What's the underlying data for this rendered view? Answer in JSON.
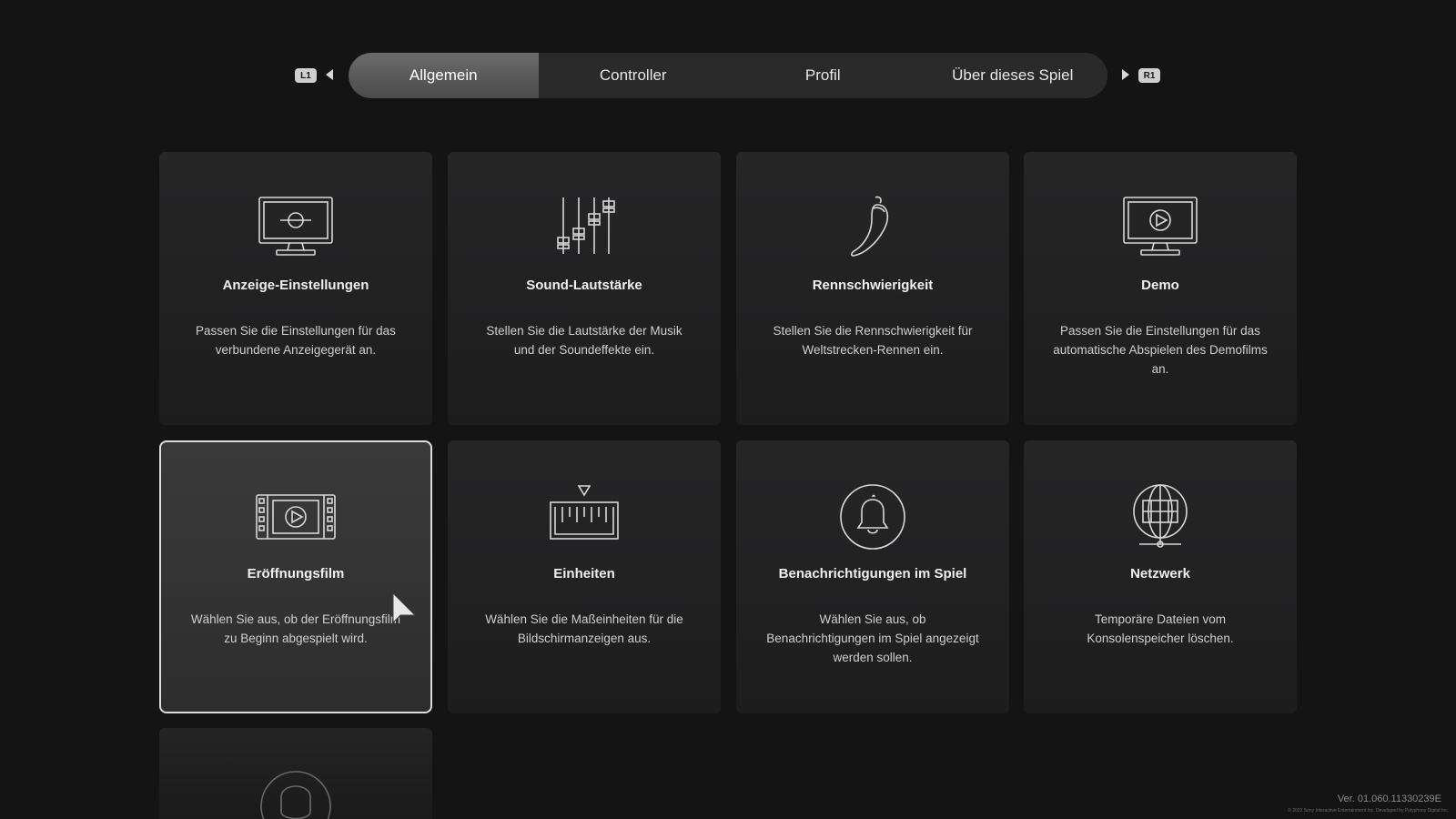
{
  "nav": {
    "left_hint": "L1",
    "right_hint": "R1",
    "tabs": [
      {
        "label": "Allgemein",
        "active": true
      },
      {
        "label": "Controller",
        "active": false
      },
      {
        "label": "Profil",
        "active": false
      },
      {
        "label": "Über dieses Spiel",
        "active": false
      }
    ]
  },
  "cards": [
    {
      "title": "Anzeige-Einstellungen",
      "desc": "Passen Sie die Einstellungen für das verbundene Anzeigegerät an.",
      "icon": "display-monitor-icon"
    },
    {
      "title": "Sound-Lautstärke",
      "desc": "Stellen Sie die Lautstärke der Musik und der Soundeffekte ein.",
      "icon": "sliders-icon"
    },
    {
      "title": "Rennschwierigkeit",
      "desc": "Stellen Sie die Rennschwierigkeit für Weltstrecken-Rennen ein.",
      "icon": "chili-pepper-icon"
    },
    {
      "title": "Demo",
      "desc": "Passen Sie die Einstellungen für das automatische Abspielen des Demofilms an.",
      "icon": "monitor-play-icon"
    },
    {
      "title": "Eröffnungsfilm",
      "desc": "Wählen Sie aus, ob der Eröffnungsfilm zu Beginn abgespielt wird.",
      "icon": "film-strip-icon",
      "selected": true
    },
    {
      "title": "Einheiten",
      "desc": "Wählen Sie die Maßeinheiten für die Bildschirmanzeigen aus.",
      "icon": "ruler-icon"
    },
    {
      "title": "Benachrichtigungen im Spiel",
      "desc": "Wählen Sie aus, ob Benachrichtigungen im Spiel angezeigt werden sollen.",
      "icon": "bell-icon"
    },
    {
      "title": "Netzwerk",
      "desc": "Temporäre Dateien vom Konsolenspeicher löschen.",
      "icon": "globe-network-icon"
    }
  ],
  "footer": {
    "version": "Ver. 01.060.11330239E",
    "copyright": "© 2022 Sony Interactive Entertainment Inc. Developed by Polyphony Digital Inc."
  },
  "colors": {
    "background": "#141414",
    "card": "#232324",
    "selected_border": "#dcdcdc",
    "tab_active": "#5a5a5a"
  }
}
